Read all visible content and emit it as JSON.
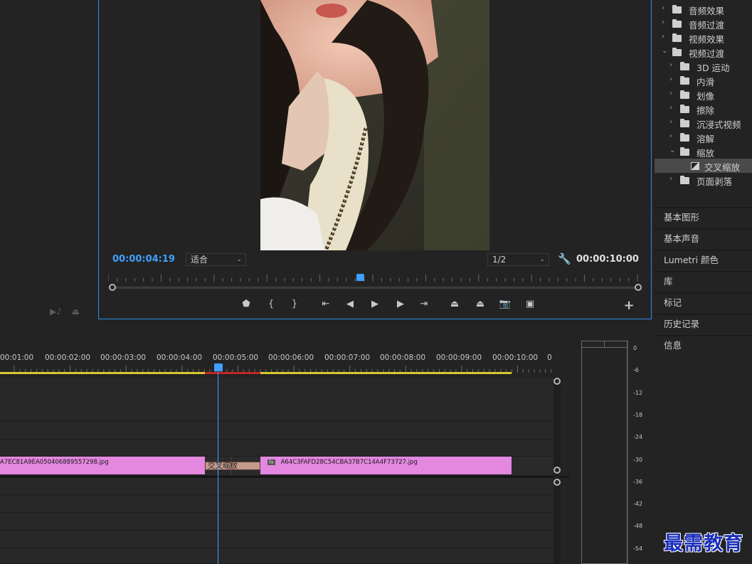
{
  "program_monitor": {
    "current_timecode": "00:00:04:19",
    "fit_select": "适合",
    "resolution_select": "1/2",
    "duration_timecode": "00:00:10:00"
  },
  "transport": [
    {
      "name": "add-marker-button",
      "glyph": "⬟"
    },
    {
      "name": "mark-in-button",
      "glyph": "{"
    },
    {
      "name": "mark-out-button",
      "glyph": "}"
    },
    {
      "name": "go-to-in-button",
      "glyph": "⇤"
    },
    {
      "name": "step-back-button",
      "glyph": "◀"
    },
    {
      "name": "play-button",
      "glyph": "▶"
    },
    {
      "name": "step-forward-button",
      "glyph": "▶"
    },
    {
      "name": "go-to-out-button",
      "glyph": "⇥"
    },
    {
      "name": "lift-button",
      "glyph": "⏏"
    },
    {
      "name": "extract-button",
      "glyph": "⏏"
    },
    {
      "name": "export-frame-button",
      "glyph": "📷"
    },
    {
      "name": "compare-view-button",
      "glyph": "▣"
    },
    {
      "name": "add-button",
      "glyph": "+"
    }
  ],
  "effects_tree": [
    {
      "label": "音频效果",
      "level": 0,
      "expanded": false
    },
    {
      "label": "音频过渡",
      "level": 0,
      "expanded": false
    },
    {
      "label": "视频效果",
      "level": 0,
      "expanded": false
    },
    {
      "label": "视频过渡",
      "level": 0,
      "expanded": true
    },
    {
      "label": "3D 运动",
      "level": 1,
      "expanded": false
    },
    {
      "label": "内滑",
      "level": 1,
      "expanded": false
    },
    {
      "label": "划像",
      "level": 1,
      "expanded": false
    },
    {
      "label": "擦除",
      "level": 1,
      "expanded": false
    },
    {
      "label": "沉浸式视频",
      "level": 1,
      "expanded": false
    },
    {
      "label": "溶解",
      "level": 1,
      "expanded": false
    },
    {
      "label": "缩放",
      "level": 1,
      "expanded": true
    },
    {
      "label": "交叉缩放",
      "level": 2,
      "effect": true,
      "selected": true
    },
    {
      "label": "页面剥落",
      "level": 1,
      "expanded": false
    }
  ],
  "side_panels": [
    "基本图形",
    "基本声音",
    "Lumetri 颜色",
    "库",
    "标记",
    "历史记录",
    "信息"
  ],
  "timeline": {
    "ruler_labels": [
      "00:01:00",
      "00:00:02:00",
      "00:00:03:00",
      "00:00:04:00",
      "00:00:05:00",
      "00:00:06:00",
      "00:00:07:00",
      "00:00:08:00",
      "00:00:09:00",
      "00:00:10:00",
      "0"
    ],
    "clip_a": "A7EC81A9EA050406889557298.jpg",
    "clip_b": "A64C3FAFD28C54CBA37B7C14A4F73727.jpg",
    "clip_b_fx": "fx",
    "transition": "交叉缩放"
  },
  "meter": {
    "db_labels": [
      "0",
      "-6",
      "-12",
      "-18",
      "-24",
      "-30",
      "-36",
      "-42",
      "-48",
      "-54"
    ]
  },
  "watermark": "最需教育",
  "colors": {
    "accent": "#3fa0ff",
    "clip": "#e387df",
    "work_area": "#d6c92d",
    "render": "#c42626"
  }
}
